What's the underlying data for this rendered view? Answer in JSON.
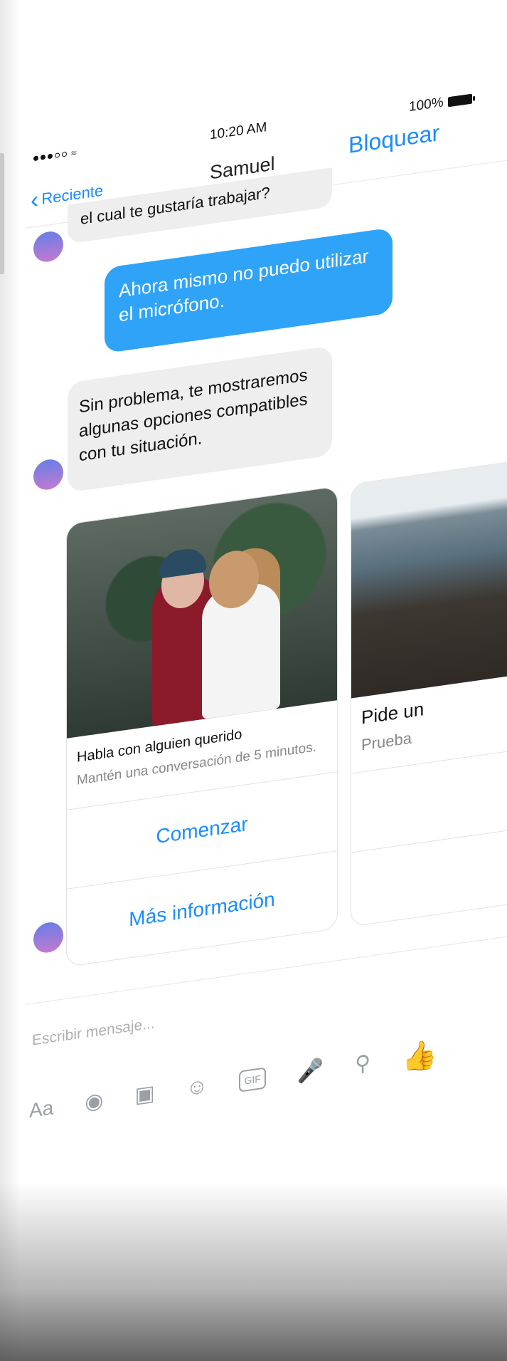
{
  "status_bar": {
    "time": "10:20 AM",
    "battery_text": "100%"
  },
  "nav": {
    "back_label": "Reciente",
    "title": "Samuel",
    "action_label": "Bloquear"
  },
  "messages": [
    {
      "from": "bot",
      "text": "el cual te gustaría trabajar?"
    },
    {
      "from": "user",
      "text": "Ahora mismo no puedo utilizar el micrófono."
    },
    {
      "from": "bot",
      "text": "Sin problema, te mostraremos algunas opciones compatibles con tu situación."
    }
  ],
  "cards": [
    {
      "title": "Habla con alguien querido",
      "subtitle": "Mantén una conversación de 5 minutos.",
      "buttons": [
        "Comenzar",
        "Más información"
      ]
    },
    {
      "title": "Pide un",
      "subtitle": "Prueba"
    }
  ],
  "compose": {
    "placeholder": "Escribir mensaje..."
  },
  "toolbar": {
    "aa_label": "Aa",
    "gif_label": "GIF",
    "icons": [
      "camera-icon",
      "gallery-icon",
      "smiley-icon",
      "gif-icon",
      "microphone-icon",
      "location-icon",
      "thumbs-up-icon"
    ]
  },
  "colors": {
    "accent": "#1a8cff",
    "outgoing_bubble": "#2fa3f8",
    "incoming_bubble": "#eeeeee"
  }
}
